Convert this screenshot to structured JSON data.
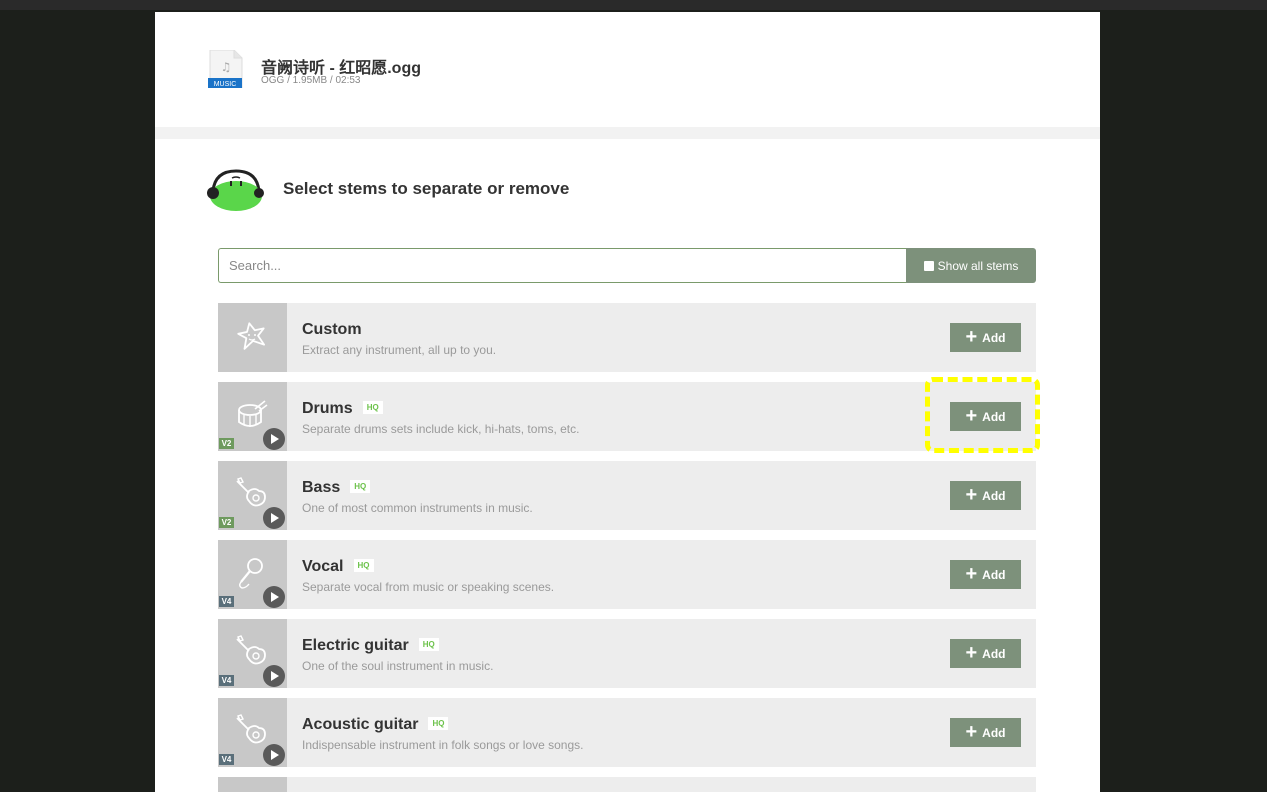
{
  "file": {
    "badge": "MUSIC",
    "title": "音阙诗听 - 红昭愿.ogg",
    "meta": "OGG / 1.95MB / 02:53"
  },
  "section": {
    "title": "Select stems to separate or remove"
  },
  "search": {
    "placeholder": "Search...",
    "show_all_label": "Show all stems"
  },
  "add_label": "Add",
  "colors": {
    "accent": "#7d917b",
    "hq": "#6cc24a",
    "highlight": "#ffff00",
    "mascot": "#5ad64a"
  },
  "stems": [
    {
      "name": "Custom",
      "hq": "",
      "desc": "Extract any instrument, all up to you.",
      "version": "",
      "icon": "star-face-icon"
    },
    {
      "name": "Drums",
      "hq": "HQ",
      "desc": "Separate drums sets include kick, hi-hats, toms, etc.",
      "version": "V2",
      "icon": "drum-icon"
    },
    {
      "name": "Bass",
      "hq": "HQ",
      "desc": "One of most common instruments in music.",
      "version": "V2",
      "icon": "guitar-icon"
    },
    {
      "name": "Vocal",
      "hq": "HQ",
      "desc": "Separate vocal from music or speaking scenes.",
      "version": "V4",
      "icon": "microphone-icon"
    },
    {
      "name": "Electric guitar",
      "hq": "HQ",
      "desc": "One of the soul instrument in music.",
      "version": "V4",
      "icon": "guitar-icon"
    },
    {
      "name": "Acoustic guitar",
      "hq": "HQ",
      "desc": "Indispensable instrument in folk songs or love songs.",
      "version": "V4",
      "icon": "guitar-icon"
    }
  ]
}
